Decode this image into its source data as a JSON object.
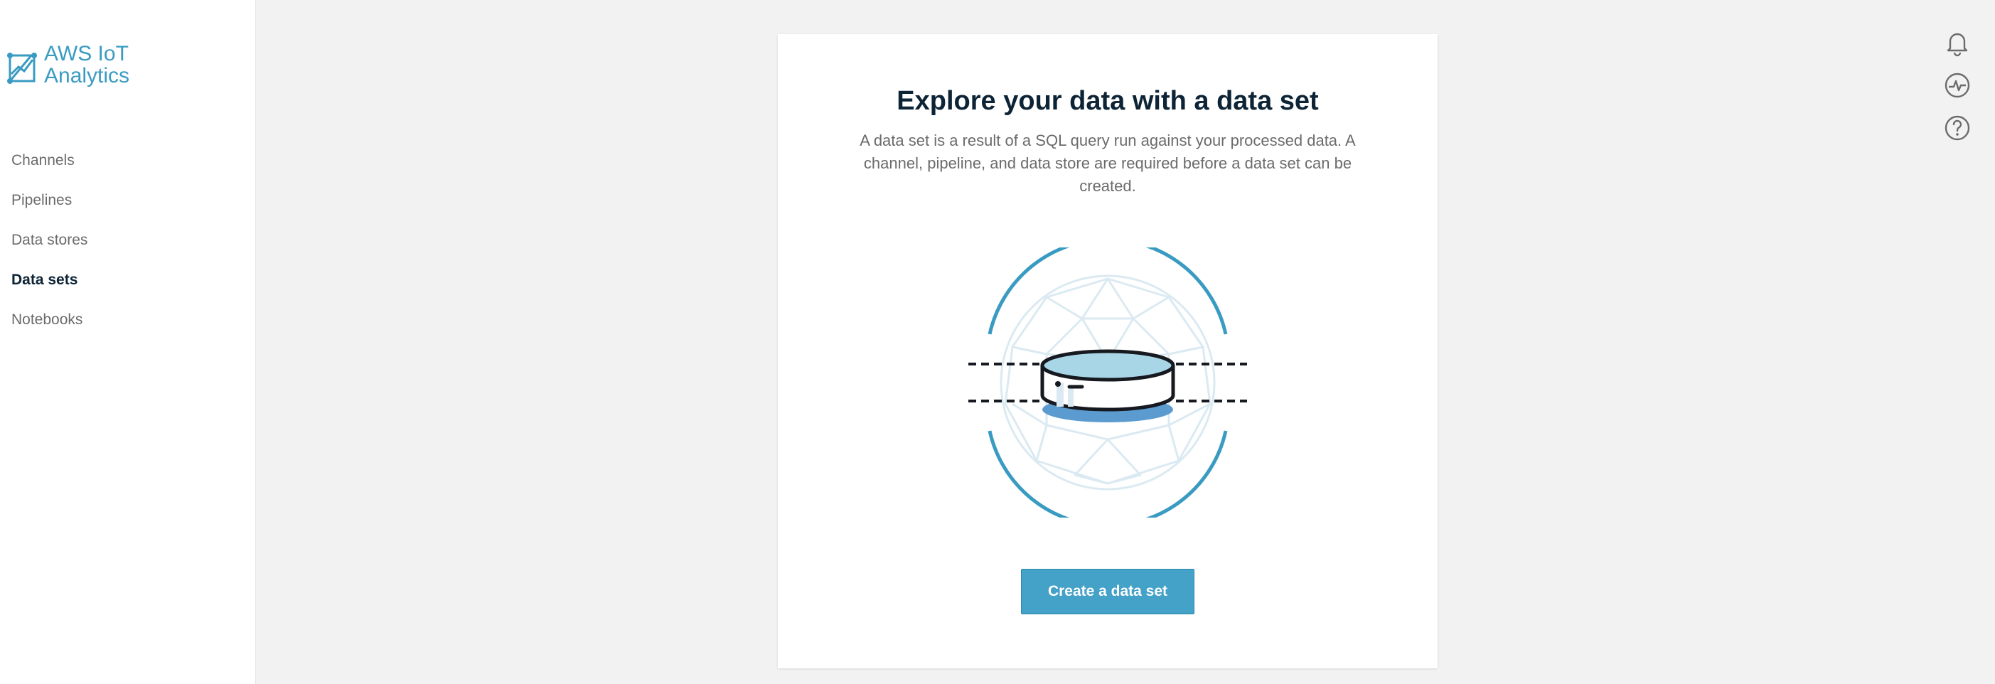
{
  "sidebar": {
    "brand": "AWS IoT\nAnalytics",
    "items": [
      {
        "label": "Channels",
        "active": false
      },
      {
        "label": "Pipelines",
        "active": false
      },
      {
        "label": "Data stores",
        "active": false
      },
      {
        "label": "Data sets",
        "active": true
      },
      {
        "label": "Notebooks",
        "active": false
      }
    ]
  },
  "main": {
    "title": "Explore your data with a data set",
    "description": "A data set is a result of a SQL query run against your processed data. A channel, pipeline, and data store are required before a data set can be created.",
    "create_button_label": "Create a data set",
    "illustration_icon": "database-sphere-illustration"
  },
  "header_icons": [
    "bell-icon",
    "activity-icon",
    "help-icon"
  ],
  "colors": {
    "brand": "#3a9bc2",
    "primary_button": "#44a1c7",
    "heading": "#0d2436",
    "muted_text": "#6b6b6b",
    "background": "#f2f2f2"
  }
}
